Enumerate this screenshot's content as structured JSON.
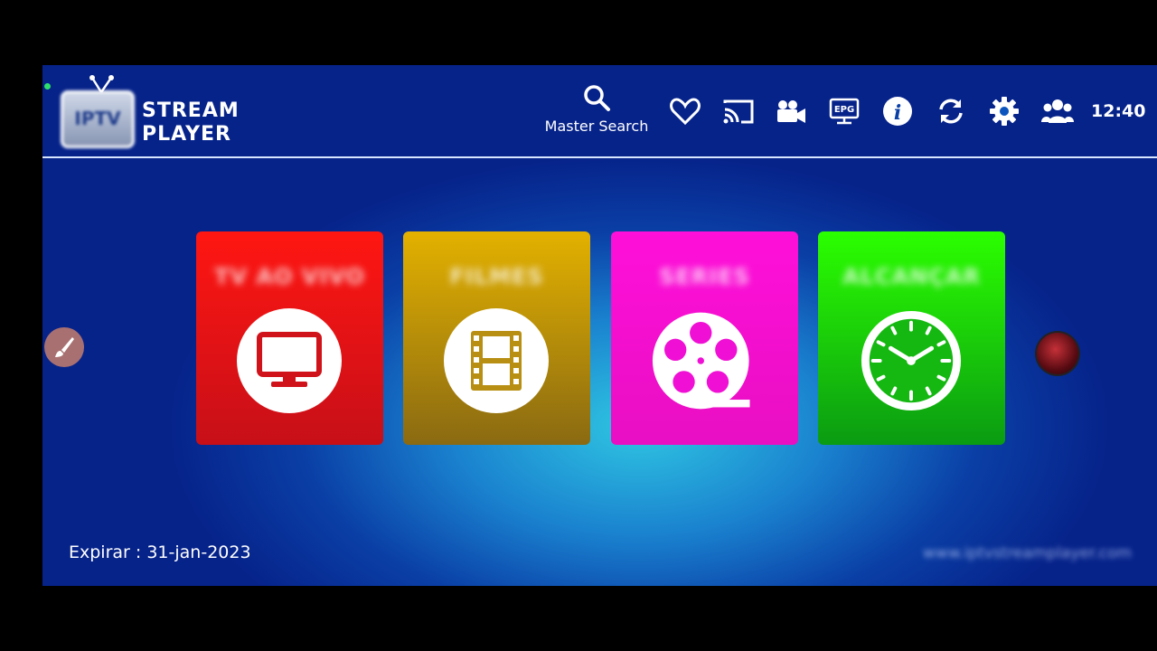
{
  "app": {
    "logo_line1": "STREAM",
    "logo_line2": "PLAYER",
    "logo_badge": "IPTV"
  },
  "header": {
    "search_label": "Master Search",
    "time": "12:40",
    "icons": [
      "favorites-heart-icon",
      "cast-icon",
      "video-camera-icon",
      "epg-icon",
      "info-icon",
      "refresh-icon",
      "settings-gear-icon",
      "users-icon"
    ]
  },
  "tiles": [
    {
      "label": "TV AO VIVO",
      "icon": "tv-monitor-icon",
      "color": "#ff1612"
    },
    {
      "label": "FILMES",
      "icon": "film-strip-icon",
      "color": "#e3b100"
    },
    {
      "label": "SERIES",
      "icon": "film-reel-icon",
      "color": "#ff0fd9"
    },
    {
      "label": "ALCANÇAR",
      "icon": "clock-icon",
      "color": "#2bff00"
    }
  ],
  "footer": {
    "expiry": "Expirar : 31-jan-2023",
    "website": "www.iptvstreamplayer.com"
  },
  "colors": {
    "background_center": "#2fc6e2",
    "background_edge": "#06238a",
    "divider": "#d9e6ff"
  }
}
